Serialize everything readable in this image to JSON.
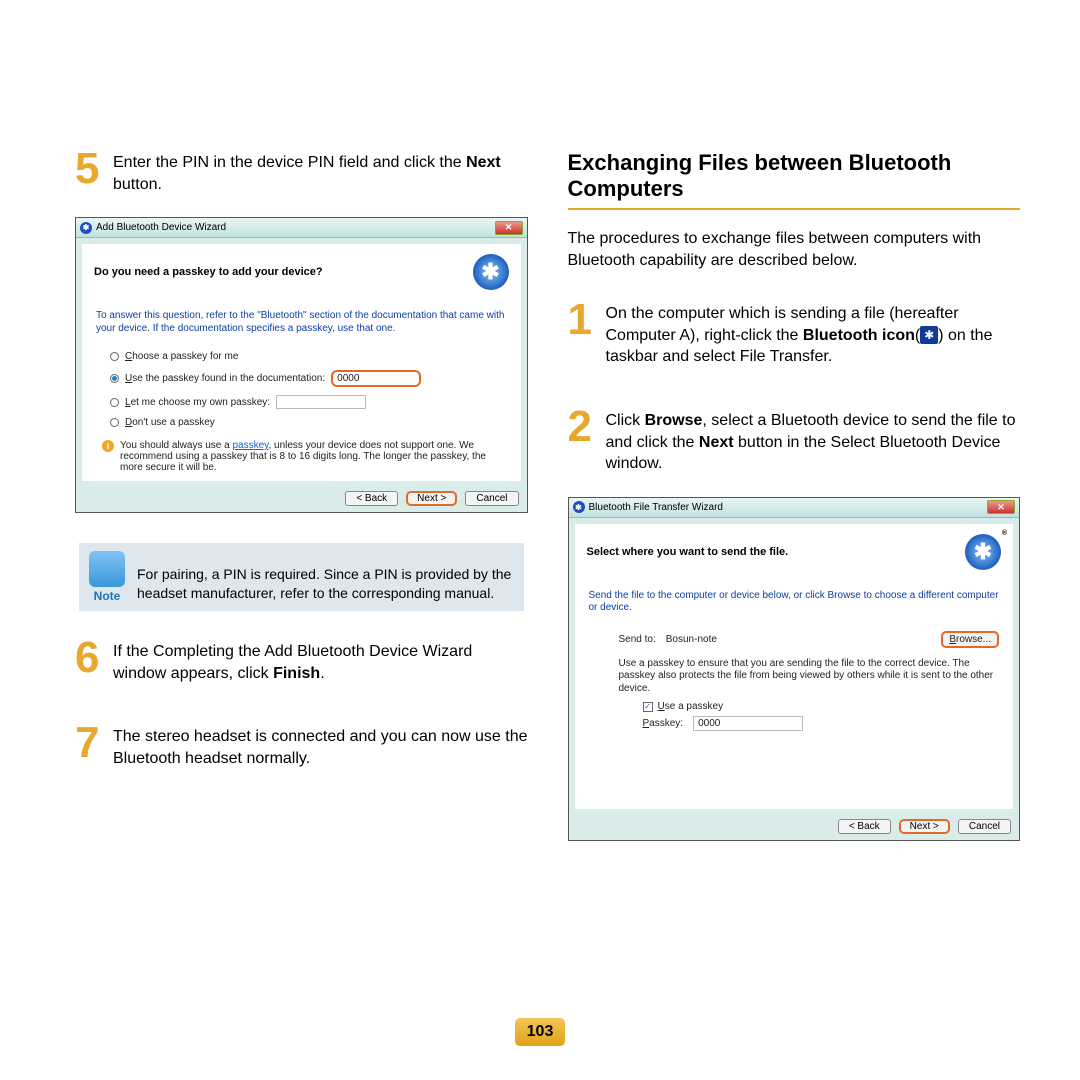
{
  "page_number": "103",
  "left": {
    "steps": {
      "s5": {
        "num": "5",
        "a": "Enter the PIN in the device PIN field and click the ",
        "b": "Next",
        "c": " button."
      },
      "s6": {
        "num": "6",
        "a": "If the Completing the Add Bluetooth Device Wizard window appears, click ",
        "b": "Finish",
        "c": "."
      },
      "s7": {
        "num": "7",
        "text": "The stereo headset is connected and you can now use the Bluetooth headset normally."
      }
    },
    "note": {
      "label": "Note",
      "text": "For pairing, a PIN is required. Since a PIN is provided by the headset manufacturer, refer to the corresponding manual."
    },
    "dialog1": {
      "title": "Add Bluetooth Device Wizard",
      "heading": "Do you need a passkey to add your device?",
      "hint": "To answer this question, refer to the \"Bluetooth\" section of the documentation that came with your device. If the documentation specifies a passkey, use that one.",
      "r1": "Choose a passkey for me",
      "r2": "Use the passkey found in the documentation:",
      "r3": "Let me choose my own passkey:",
      "r4": "Don't use a passkey",
      "pin": "0000",
      "info_a": "You should always use a ",
      "info_link": "passkey",
      "info_b": ", unless your device does not support one. We recommend using a passkey that is 8 to 16 digits long. The longer the passkey, the more secure it will be.",
      "back": "< Back",
      "next": "Next >",
      "cancel": "Cancel"
    }
  },
  "right": {
    "heading": "Exchanging Files between Bluetooth Computers",
    "intro": "The procedures to exchange files between computers with Bluetooth capability are described below.",
    "steps": {
      "s1": {
        "num": "1",
        "a": "On the computer which is sending a file (hereafter Computer A), right-click the ",
        "b": "Bluetooth icon",
        "c": "(",
        "d": ") on the taskbar and select File Transfer."
      },
      "s2": {
        "num": "2",
        "a": "Click ",
        "b": "Browse",
        "c": ", select a Bluetooth device to send the file to and click the ",
        "d": "Next",
        "e": " button in the Select Bluetooth Device window."
      }
    },
    "dialog2": {
      "title": "Bluetooth File Transfer Wizard",
      "heading": "Select where you want to send the file.",
      "hint": "Send the file to the computer or device below, or click Browse to choose a different computer or device.",
      "sendto_label": "Send to:",
      "sendto_value": "Bosun-note",
      "browse": "Browse...",
      "hint2": "Use a passkey to ensure that you are sending the file to the correct device. The passkey also protects the file from being viewed by others while it is sent to the other device.",
      "use_passkey": "Use a passkey",
      "passkey_label": "Passkey:",
      "passkey_value": "0000",
      "back": "< Back",
      "next": "Next >",
      "cancel": "Cancel"
    }
  }
}
